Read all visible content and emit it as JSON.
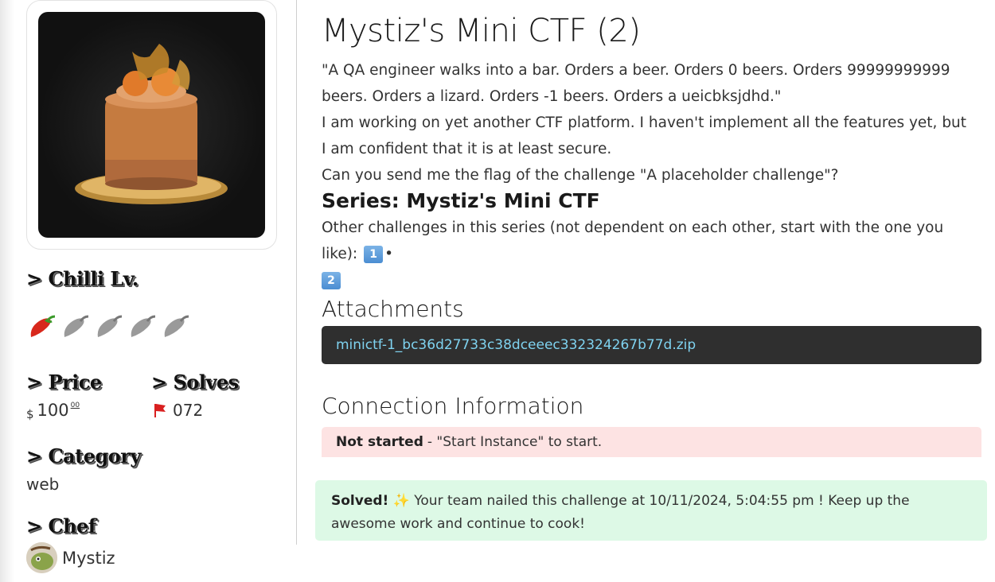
{
  "challenge": {
    "title": "Mystiz's Mini CTF (2)",
    "quote": "\"A QA engineer walks into a bar. Orders a beer. Orders 0 beers. Orders 99999999999 beers. Orders a lizard. Orders -1 beers. Orders a ueicbksjdhd.\"",
    "desc1": "I am working on yet another CTF platform. I haven't implement all the features yet, but I am confident that it is at least secure.",
    "desc2": "Can you send me the flag of the challenge \"A placeholder challenge\"?"
  },
  "series": {
    "heading": "Series: Mystiz's Mini CTF",
    "text": "Other challenges in this series (not dependent on each other, start with the one you like):",
    "links": [
      "1️⃣",
      "2️⃣"
    ],
    "separator": "•"
  },
  "attachments": {
    "heading": "Attachments",
    "file": "minictf-1_bc36d27733c38dceeec332324267b77d.zip"
  },
  "connection": {
    "heading": "Connection Information",
    "status": "Not started",
    "hint": "- \"Start Instance\" to start."
  },
  "solved": {
    "label": "Solved!",
    "emoji": "✨",
    "message": "Your team nailed this challenge at 10/11/2024, 5:04:55 pm ! Keep up the awesome work and continue to cook!"
  },
  "sidebar": {
    "chilli_heading": "> Chilli Lv.",
    "chilli_level": 1,
    "chilli_max": 5,
    "price_heading": "> Price",
    "price_currency": "$",
    "price_amount": "100",
    "price_cents": "00",
    "solves_heading": "> Solves",
    "solves_count": "072",
    "category_heading": "> Category",
    "category": "web",
    "chef_heading": "> Chef",
    "chef_name": "Mystiz"
  },
  "colors": {
    "chilli_active": "#d8281c",
    "chilli_inactive": "#9a9a9a",
    "flag": "#d92020",
    "solved_bg": "#ddf9e6",
    "notstarted_bg": "#fde3e3",
    "attachment_bg": "#2f2f2f",
    "link": "#7fd3f0"
  }
}
